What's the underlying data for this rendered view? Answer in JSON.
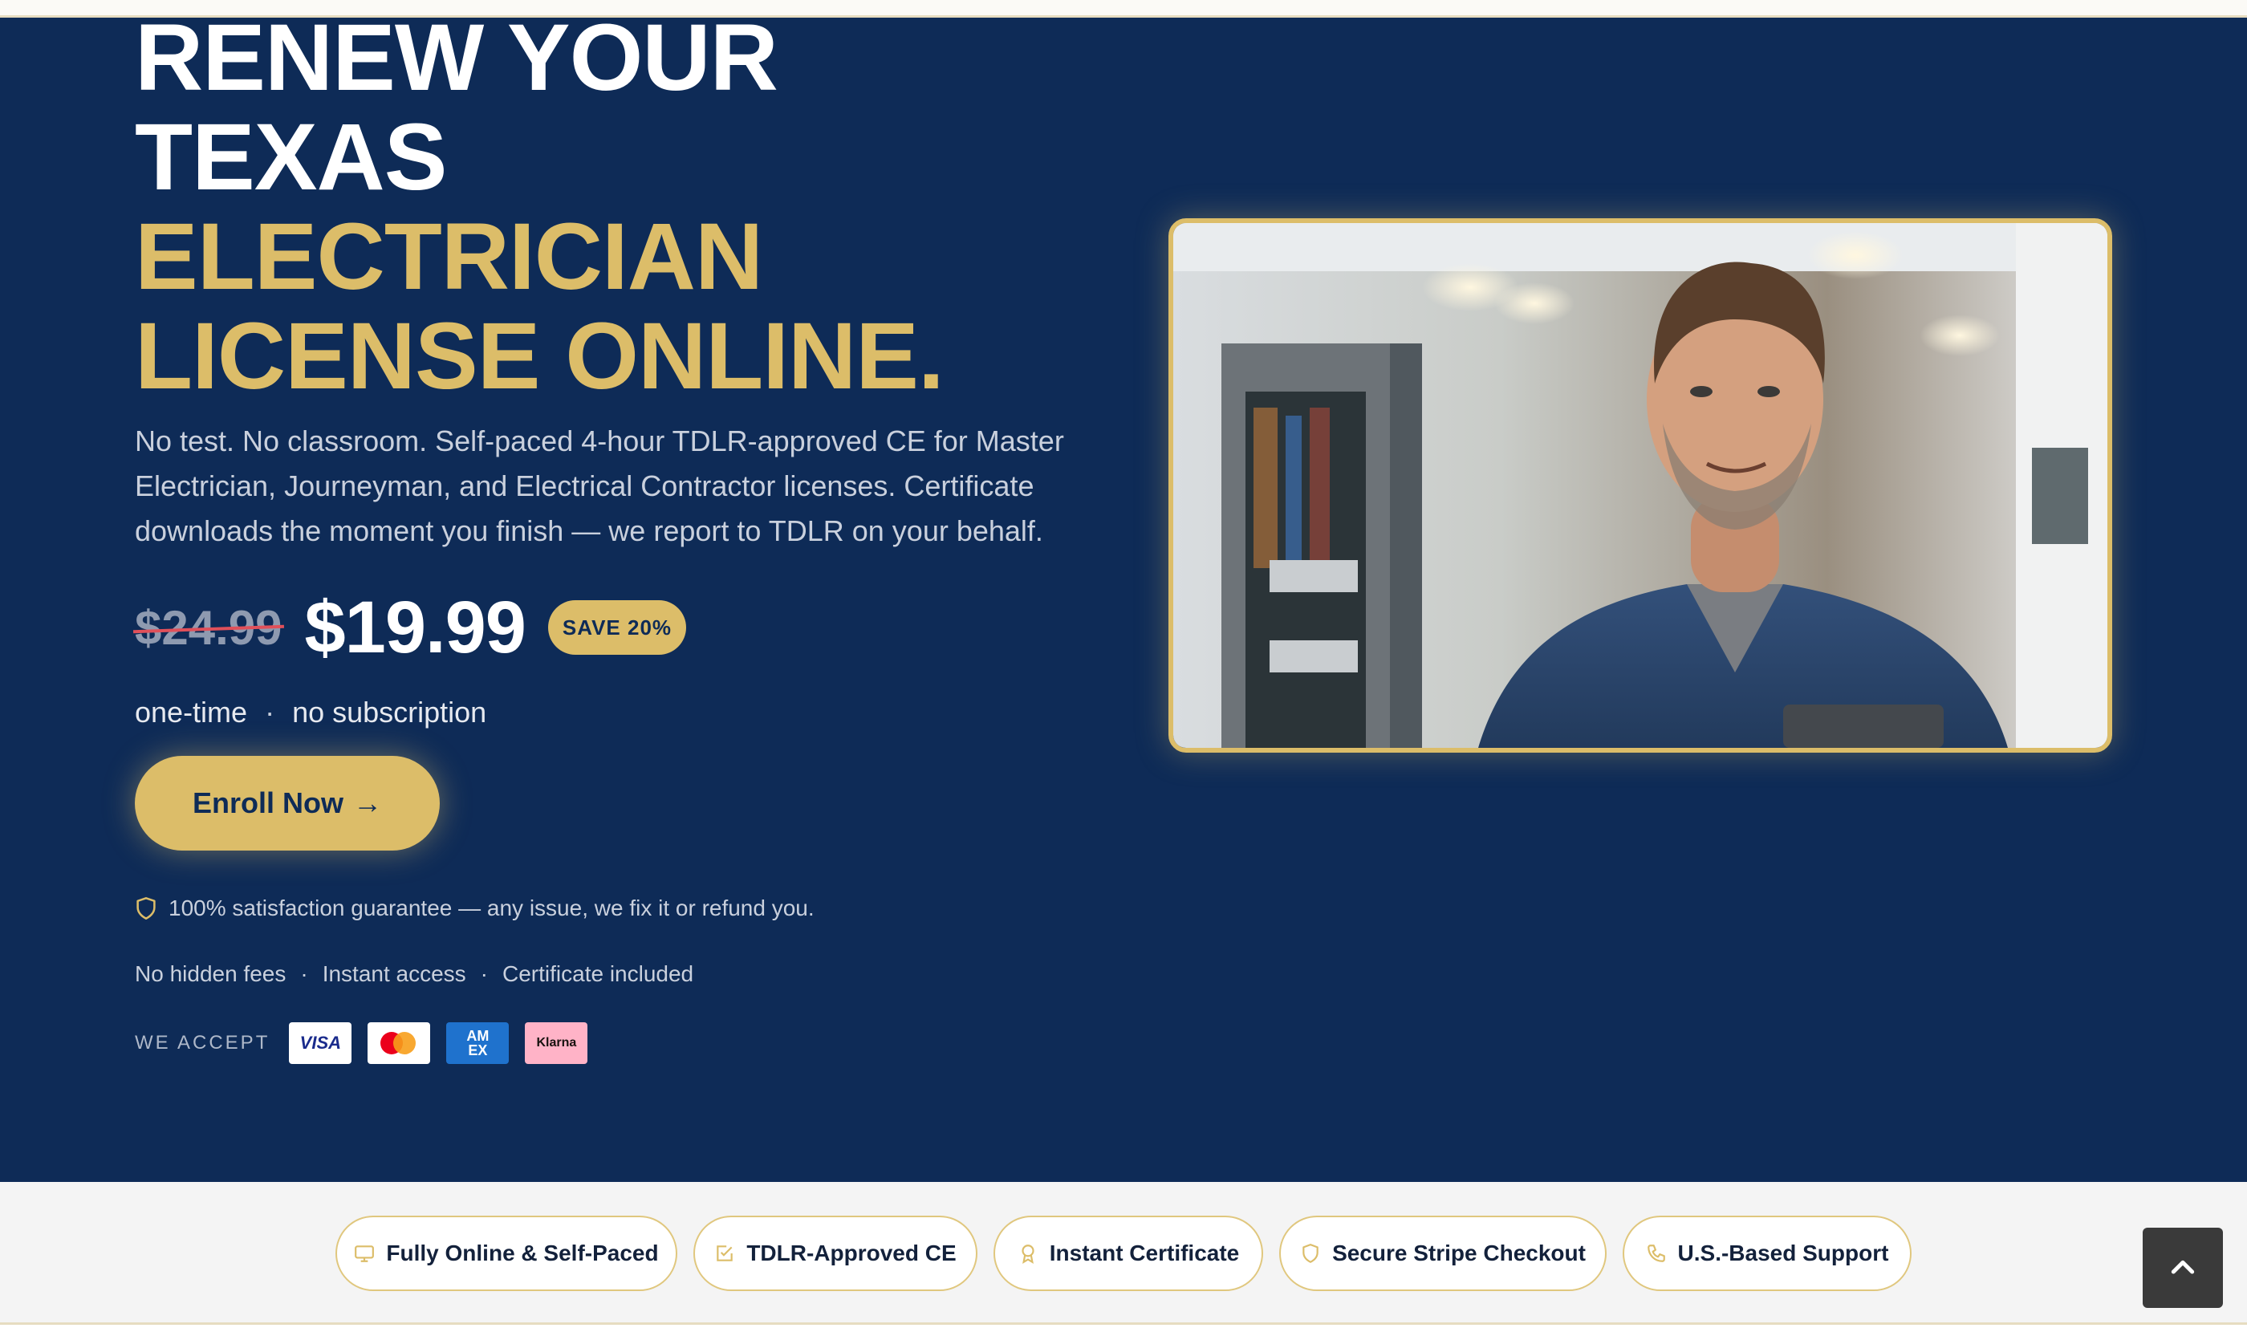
{
  "hero": {
    "headline": {
      "line1": "RENEW YOUR",
      "line2": "TEXAS",
      "line3": "ELECTRICIAN",
      "line4": "LICENSE ONLINE."
    },
    "subtext": "No test. No classroom. Self-paced 4-hour TDLR-approved CE for Master Electrician, Journeyman, and Electrical Contractor licenses. Certificate downloads the moment you finish — we report to TDLR on your behalf.",
    "pricing": {
      "old_price": "$24.99",
      "new_price": "$19.99",
      "badge": "SAVE 20%",
      "note_one": "one-time",
      "note_separator": "·",
      "note_two": "no subscription"
    },
    "enroll_button": {
      "label": "Enroll Now",
      "arrow": "→"
    },
    "guarantee": "100% satisfaction guarantee — any issue, we fix it or refund you.",
    "features": {
      "item1": "No hidden fees",
      "item2": "Instant access",
      "item3": "Certificate included",
      "separator": "·"
    },
    "payment": {
      "label": "WE ACCEPT",
      "visa": "VISA",
      "amex_line1": "AM",
      "amex_line2": "EX",
      "klarna": "Klarna"
    }
  },
  "trust_pills": [
    {
      "label": "Fully Online & Self-Paced",
      "icon": "monitor-icon"
    },
    {
      "label": "TDLR-Approved CE",
      "icon": "checklist-icon"
    },
    {
      "label": "Instant Certificate",
      "icon": "award-icon"
    },
    {
      "label": "Secure Stripe Checkout",
      "icon": "shield-icon"
    },
    {
      "label": "U.S.-Based Support",
      "icon": "phone-icon"
    }
  ],
  "colors": {
    "navy": "#0e2b57",
    "gold": "#dcbd69",
    "strip": "#f4f4f4"
  }
}
